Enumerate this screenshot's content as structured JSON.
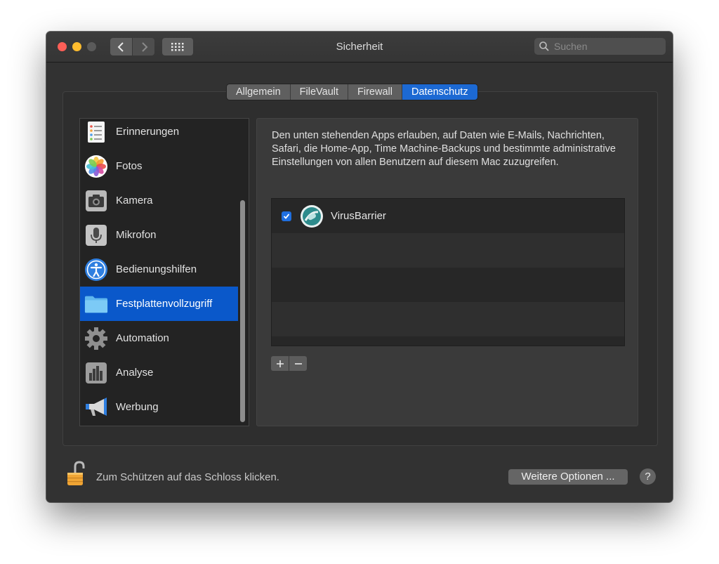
{
  "window": {
    "title": "Sicherheit",
    "search_placeholder": "Suchen"
  },
  "tabs": [
    {
      "label": "Allgemein"
    },
    {
      "label": "FileVault"
    },
    {
      "label": "Firewall"
    },
    {
      "label": "Datenschutz",
      "active": true
    }
  ],
  "sidebar": {
    "items": [
      {
        "label": "Erinnerungen",
        "icon": "reminders-icon"
      },
      {
        "label": "Fotos",
        "icon": "photos-icon"
      },
      {
        "label": "Kamera",
        "icon": "camera-icon"
      },
      {
        "label": "Mikrofon",
        "icon": "microphone-icon"
      },
      {
        "label": "Bedienungshilfen",
        "icon": "accessibility-icon"
      },
      {
        "label": "Festplattenvollzugriff",
        "icon": "folder-icon",
        "selected": true
      },
      {
        "label": "Automation",
        "icon": "gear-icon"
      },
      {
        "label": "Analyse",
        "icon": "analytics-icon"
      },
      {
        "label": "Werbung",
        "icon": "megaphone-icon"
      }
    ]
  },
  "panel": {
    "description": "Den unten stehenden Apps erlauben, auf Daten wie E-Mails, Nachrichten, Safari, die Home-App, Time Machine-Backups und bestimmte administrative Einstellungen von allen Benutzern auf diesem Mac zuzugreifen.",
    "apps": [
      {
        "name": "VirusBarrier",
        "checked": true,
        "icon": "virusbarrier-icon"
      }
    ]
  },
  "footer": {
    "lock_text": "Zum Schützen auf das Schloss klicken.",
    "options_button": "Weitere Optionen ...",
    "help_label": "?"
  },
  "colors": {
    "accent": "#1c69d3",
    "selection": "#0a58ca",
    "window_bg": "#323232"
  }
}
